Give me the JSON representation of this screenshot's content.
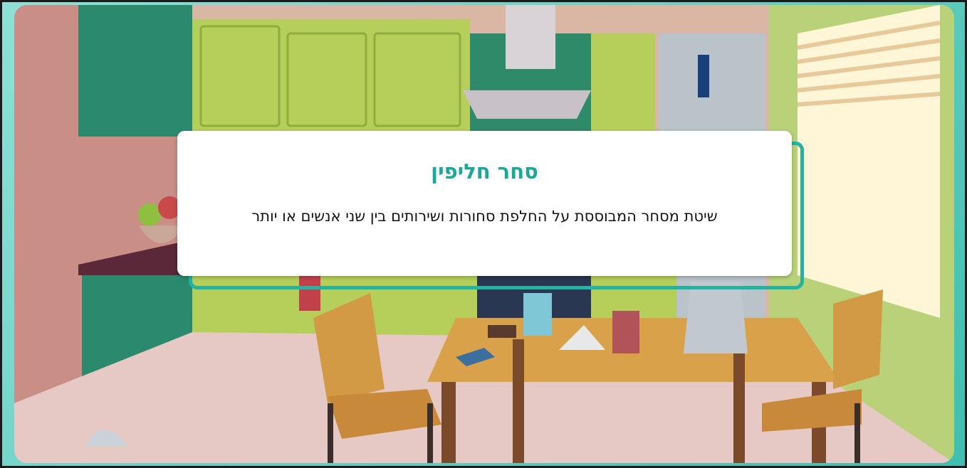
{
  "card": {
    "title": "סחר חליפין",
    "definition": "שיטת מסחר המבוססת על החלפת סחורות ושירותים בין שני אנשים או יותר"
  },
  "background": {
    "scene": "kitchen-illustration"
  },
  "colors": {
    "accent": "#1aa89a",
    "frame": "#3fbfb0",
    "card_background": "#ffffff"
  }
}
